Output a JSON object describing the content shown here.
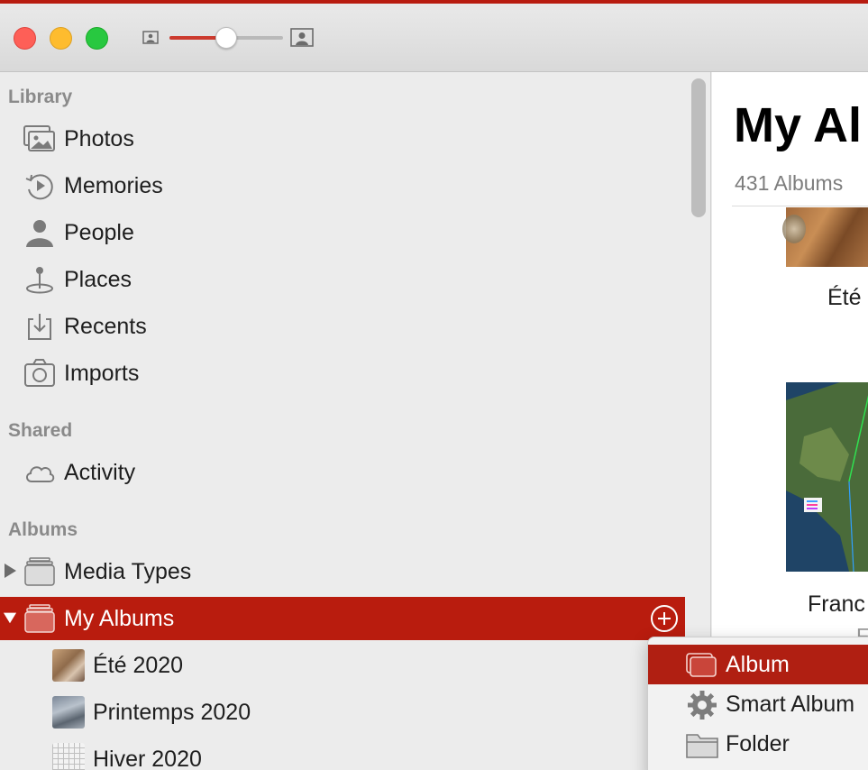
{
  "app": {
    "accent_color": "#b81c10"
  },
  "toolbar": {
    "traffic_lights": [
      "close",
      "minimize",
      "zoom"
    ],
    "zoom_slider": {
      "value": 0.5,
      "small_icon": "person-photo-small-icon",
      "large_icon": "person-photo-large-icon"
    }
  },
  "sidebar": {
    "sections": {
      "library": "Library",
      "shared": "Shared",
      "albums": "Albums"
    },
    "library_items": [
      {
        "label": "Photos",
        "icon": "photos-icon"
      },
      {
        "label": "Memories",
        "icon": "memories-icon"
      },
      {
        "label": "People",
        "icon": "person-icon"
      },
      {
        "label": "Places",
        "icon": "pin-icon"
      },
      {
        "label": "Recents",
        "icon": "download-tray-icon"
      },
      {
        "label": "Imports",
        "icon": "camera-icon"
      }
    ],
    "shared_items": [
      {
        "label": "Activity",
        "icon": "cloud-icon"
      }
    ],
    "album_items": [
      {
        "label": "Media Types",
        "icon": "album-stack-icon",
        "expanded": false
      },
      {
        "label": "My Albums",
        "icon": "album-stack-icon",
        "expanded": true,
        "selected": true
      }
    ],
    "my_albums": [
      {
        "label": "Été 2020"
      },
      {
        "label": "Printemps 2020"
      },
      {
        "label": "Hiver 2020"
      }
    ]
  },
  "main": {
    "title": "My Al",
    "album_count": "431 Albums",
    "albums": [
      {
        "name": "Été"
      },
      {
        "name": "Franc"
      }
    ],
    "partial_text": "F"
  },
  "add_menu": {
    "items": [
      {
        "label": "Album",
        "icon": "album-icon",
        "highlighted": true
      },
      {
        "label": "Smart Album",
        "icon": "gear-icon",
        "highlighted": false
      },
      {
        "label": "Folder",
        "icon": "folder-icon",
        "highlighted": false
      }
    ]
  }
}
